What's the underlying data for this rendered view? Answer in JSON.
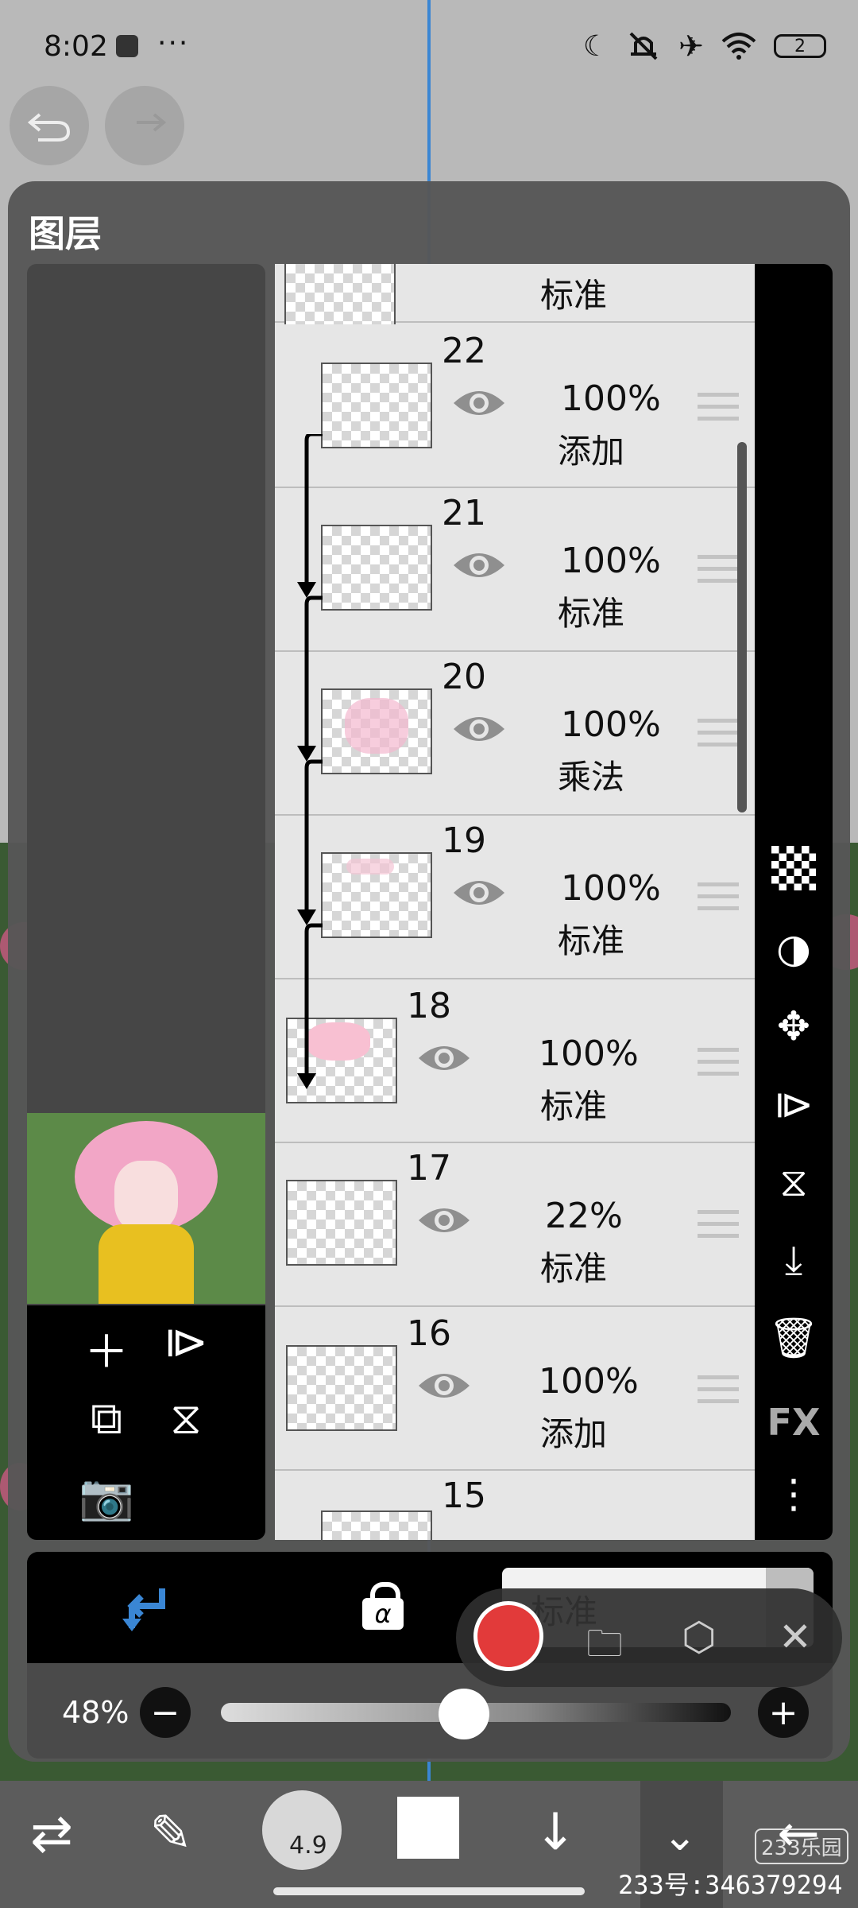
{
  "status": {
    "time": "8:02",
    "dots": "···",
    "battery": "2"
  },
  "panel": {
    "title": "图层"
  },
  "layers": [
    {
      "num": "",
      "opacity": "",
      "blend": "标准"
    },
    {
      "num": "22",
      "opacity": "100%",
      "blend": "添加"
    },
    {
      "num": "21",
      "opacity": "100%",
      "blend": "标准"
    },
    {
      "num": "20",
      "opacity": "100%",
      "blend": "乘法"
    },
    {
      "num": "19",
      "opacity": "100%",
      "blend": "标准"
    },
    {
      "num": "18",
      "opacity": "100%",
      "blend": "标准"
    },
    {
      "num": "17",
      "opacity": "22%",
      "blend": "标准"
    },
    {
      "num": "16",
      "opacity": "100%",
      "blend": "添加"
    },
    {
      "num": "15",
      "opacity": "",
      "blend": ""
    }
  ],
  "right_tools": {
    "fx": "FX",
    "more": "⋮"
  },
  "bottom": {
    "blend_mode": "标准",
    "alpha_label": "α",
    "opacity_percent": "48%",
    "opacity_value": 0.48
  },
  "toolbar": {
    "brush_size": "4.9"
  },
  "watermark": {
    "text": "233号:346379294",
    "badge": "233乐园"
  },
  "colors": {
    "accent": "#3a86d4",
    "record": "#e23a3a",
    "panel": "#565656"
  }
}
